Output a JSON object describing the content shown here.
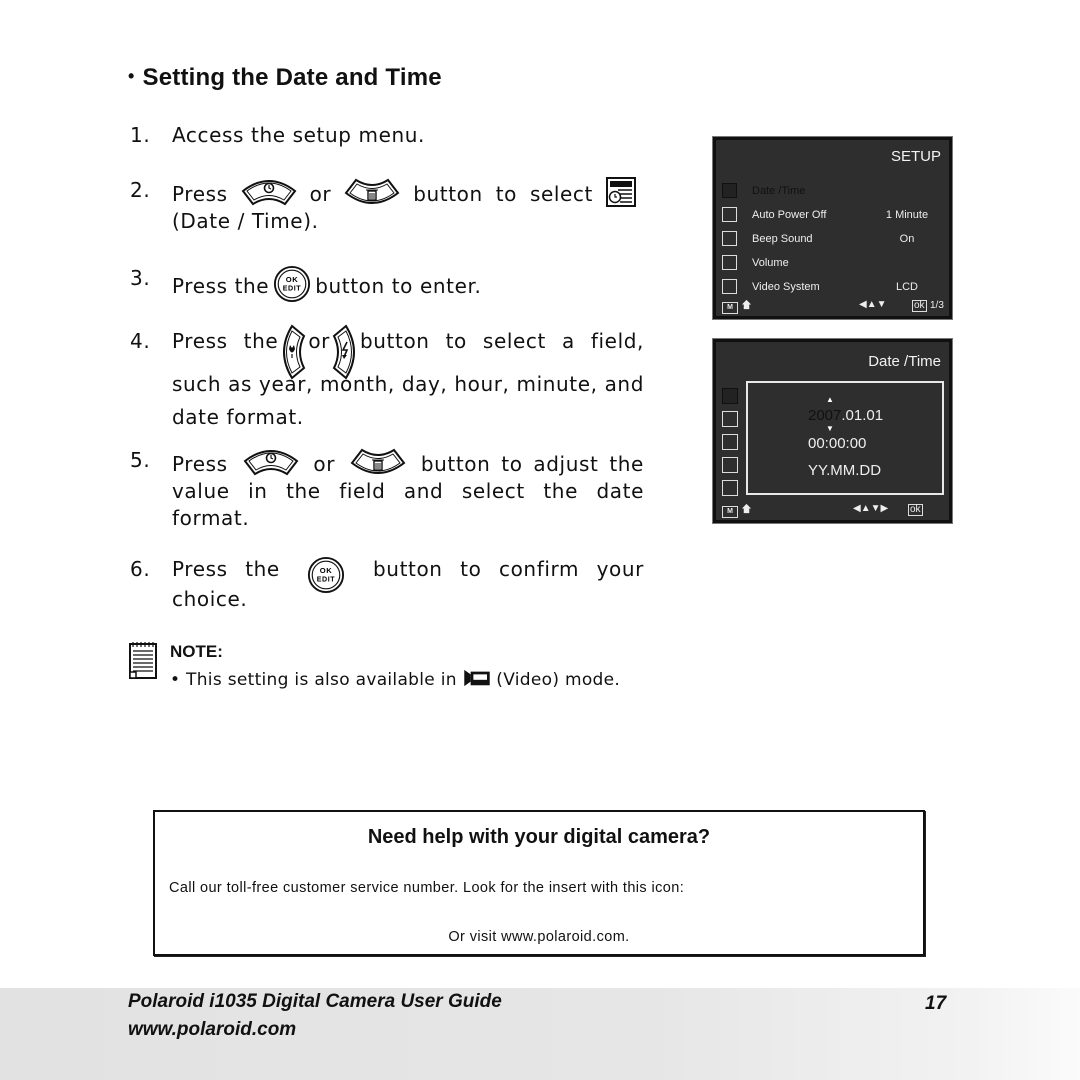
{
  "section": {
    "bullet": "•",
    "title": "Setting the Date and Time"
  },
  "steps": [
    {
      "num": "1.",
      "text": "Access the setup menu."
    },
    {
      "num": "2.",
      "pre": "Press",
      "or": "or",
      "post": "button to select",
      "tail": "(Date / Time)."
    },
    {
      "num": "3.",
      "pre": "Press the",
      "post": "button to enter."
    },
    {
      "num": "4.",
      "pre": "Press the",
      "or": "or",
      "post": "button to select a field, such as year, month, day, hour, minute, and date format."
    },
    {
      "num": "5.",
      "pre": "Press",
      "or": "or",
      "post": "button to adjust the value in the field and select the date format."
    },
    {
      "num": "6.",
      "pre": "Press the",
      "post": "button to confirm your choice."
    }
  ],
  "icons": {
    "up_button": "self-timer-up-button-icon",
    "down_button": "delete-down-button-icon",
    "ok_edit_button": "ok-edit-button-icon",
    "left_button": "macro-left-button-icon",
    "right_button": "flash-right-button-icon",
    "date_time": "date-time-icon",
    "video_mode": "video-mode-icon",
    "note": "notepad-icon",
    "ok_label": "OK",
    "edit_label": "EDIT"
  },
  "setup_screen": {
    "header": "SETUP",
    "items": [
      {
        "label": "Date /Time",
        "value": "",
        "icon": "date-time-icon",
        "selected": true
      },
      {
        "label": "Auto Power Off",
        "value": "1 Minute",
        "icon": "power-icon",
        "selected": false
      },
      {
        "label": "Beep Sound",
        "value": "On",
        "icon": "speaker-icon",
        "selected": false
      },
      {
        "label": "Volume",
        "value": "",
        "icon": "volume-bars-icon",
        "selected": false
      },
      {
        "label": "Video System",
        "value": "LCD",
        "icon": "tv-icon",
        "selected": false
      }
    ],
    "footer": {
      "menu_key": "M",
      "nav": "◀▲▼",
      "ok": "ok",
      "page": "1/3"
    }
  },
  "datetime_screen": {
    "header": "Date /Time",
    "year": "2007",
    "date_rest": ".01.01",
    "time": "00:00:00",
    "format": "YY.MM.DD",
    "footer": {
      "menu_key": "M",
      "nav": "◀▲▼▶",
      "ok": "ok"
    }
  },
  "note": {
    "title": "NOTE:",
    "bullet": "•",
    "text_pre": "This setting is also available in",
    "text_post": "(Video) mode."
  },
  "help_box": {
    "heading": "Need help with your digital camera?",
    "line1": "Call our toll-free customer service number. Look for the insert with this icon:",
    "line2": "Or visit www.polaroid.com."
  },
  "footer": {
    "guide_title": "Polaroid i1035 Digital Camera User Guide",
    "url": "www.polaroid.com",
    "page_number": "17"
  }
}
